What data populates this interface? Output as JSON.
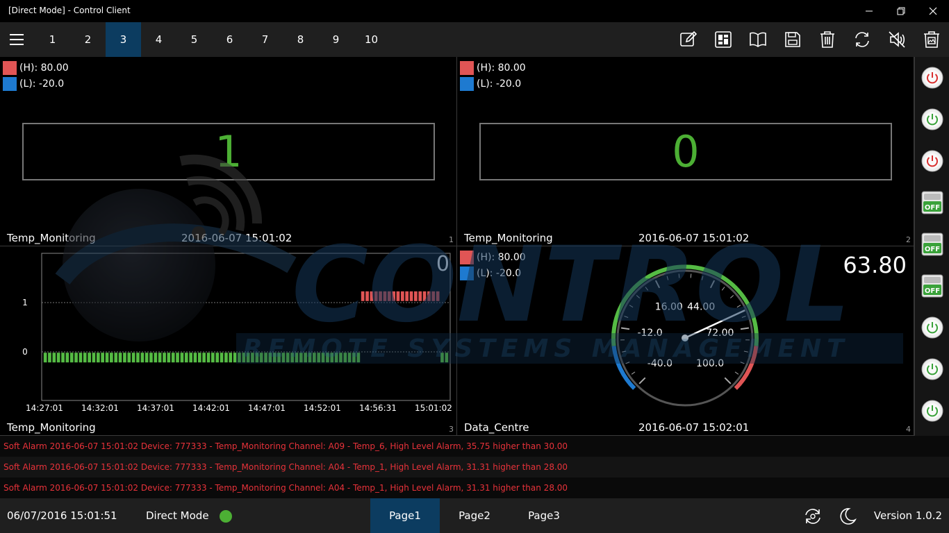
{
  "window": {
    "title": "[Direct Mode] - Control Client"
  },
  "toolbar": {
    "tabs": [
      "1",
      "2",
      "3",
      "4",
      "5",
      "6",
      "7",
      "8",
      "9",
      "10"
    ],
    "active_tab": "3",
    "tools": [
      "edit-icon",
      "dashboard-icon",
      "book-icon",
      "save-icon",
      "delete-icon",
      "refresh-icon",
      "mute-icon",
      "clear-image-icon"
    ]
  },
  "watermark": {
    "brand": "CONTROL",
    "tagline": "REMOTE SYSTEMS MANAGEMENT"
  },
  "panels": [
    {
      "num": "1",
      "legend_high": "(H): 80.00",
      "legend_low": "(L): -20.0",
      "value": "1",
      "name": "Temp_Monitoring",
      "time": "2016-06-07 15:01:02"
    },
    {
      "num": "2",
      "legend_high": "(H): 80.00",
      "legend_low": "(L): -20.0",
      "value": "0",
      "name": "Temp_Monitoring",
      "time": "2016-06-07 15:01:02"
    },
    {
      "num": "3",
      "value": "0",
      "name": "Temp_Monitoring"
    },
    {
      "num": "4",
      "legend_high": "(H): 80.00",
      "legend_low": "(L): -20.0",
      "value": "63.80",
      "name": "Data_Centre",
      "time": "2016-06-07 15:02:01"
    }
  ],
  "chart_data": [
    {
      "type": "bar",
      "title": "",
      "x_tick_labels": [
        "14:27:01",
        "14:32:01",
        "14:37:01",
        "14:42:01",
        "14:47:01",
        "14:52:01",
        "14:56:31",
        "15:01:02"
      ],
      "y_ticks": [
        "1",
        "0"
      ],
      "ylim": [
        -0.7,
        1.7
      ],
      "grid": false,
      "series": [
        {
          "values": [
            0,
            0,
            0,
            0,
            0,
            0,
            0,
            0,
            0,
            0,
            0,
            0,
            0,
            0,
            0,
            0,
            0,
            0,
            0,
            0,
            0,
            0,
            0,
            0,
            0,
            0,
            0,
            0,
            0,
            0,
            0,
            0,
            0,
            0,
            0,
            0,
            0,
            0,
            0,
            0,
            0,
            0,
            0,
            0,
            0,
            0,
            0,
            0,
            0,
            0,
            0,
            0,
            0,
            0,
            0,
            0,
            0,
            0,
            0,
            0,
            0,
            0,
            0,
            0,
            0,
            0,
            0,
            0,
            0,
            0,
            0,
            0,
            1,
            1,
            1,
            1,
            1,
            1,
            1,
            1,
            1,
            1,
            1,
            1,
            1,
            1,
            1,
            1,
            1,
            1,
            0,
            0
          ]
        }
      ],
      "color_on": "#e05555",
      "color_off": "#55bb44"
    },
    {
      "type": "gauge",
      "value": 63.8,
      "min": -40,
      "max": 100,
      "tick_labels": [
        "-40.0",
        "-12.0",
        "16.00",
        "44.00",
        "72.00",
        "100.0"
      ],
      "colors": {
        "low": "#1e7ad0",
        "normal": "#55bb44",
        "high": "#e05555"
      }
    }
  ],
  "side_buttons": [
    {
      "icon": "power-red-icon"
    },
    {
      "icon": "power-green-icon"
    },
    {
      "icon": "power-red-icon"
    },
    {
      "icon": "off-switch-icon",
      "label": "OFF"
    },
    {
      "icon": "off-switch-icon",
      "label": "OFF"
    },
    {
      "icon": "off-switch-icon",
      "label": "OFF"
    },
    {
      "icon": "power-green-icon"
    },
    {
      "icon": "power-green-icon"
    },
    {
      "icon": "power-green-icon"
    }
  ],
  "alarms": [
    "Soft Alarm 2016-06-07 15:01:02 Device: 777333 - Temp_Monitoring Channel: A09 - Temp_6, High Level Alarm, 35.75 higher than 30.00",
    "Soft Alarm 2016-06-07 15:01:02 Device: 777333 - Temp_Monitoring Channel: A04 - Temp_1, High Level Alarm, 31.31 higher than 28.00",
    "Soft Alarm 2016-06-07 15:01:02 Device: 777333 - Temp_Monitoring Channel: A04 - Temp_1, High Level Alarm, 31.31 higher than 28.00"
  ],
  "statusbar": {
    "datetime": "06/07/2016 15:01:51",
    "mode": "Direct Mode",
    "mode_color": "#4caf34",
    "pages": [
      "Page1",
      "Page2",
      "Page3"
    ],
    "active_page": "Page1",
    "version": "Version 1.0.2"
  }
}
